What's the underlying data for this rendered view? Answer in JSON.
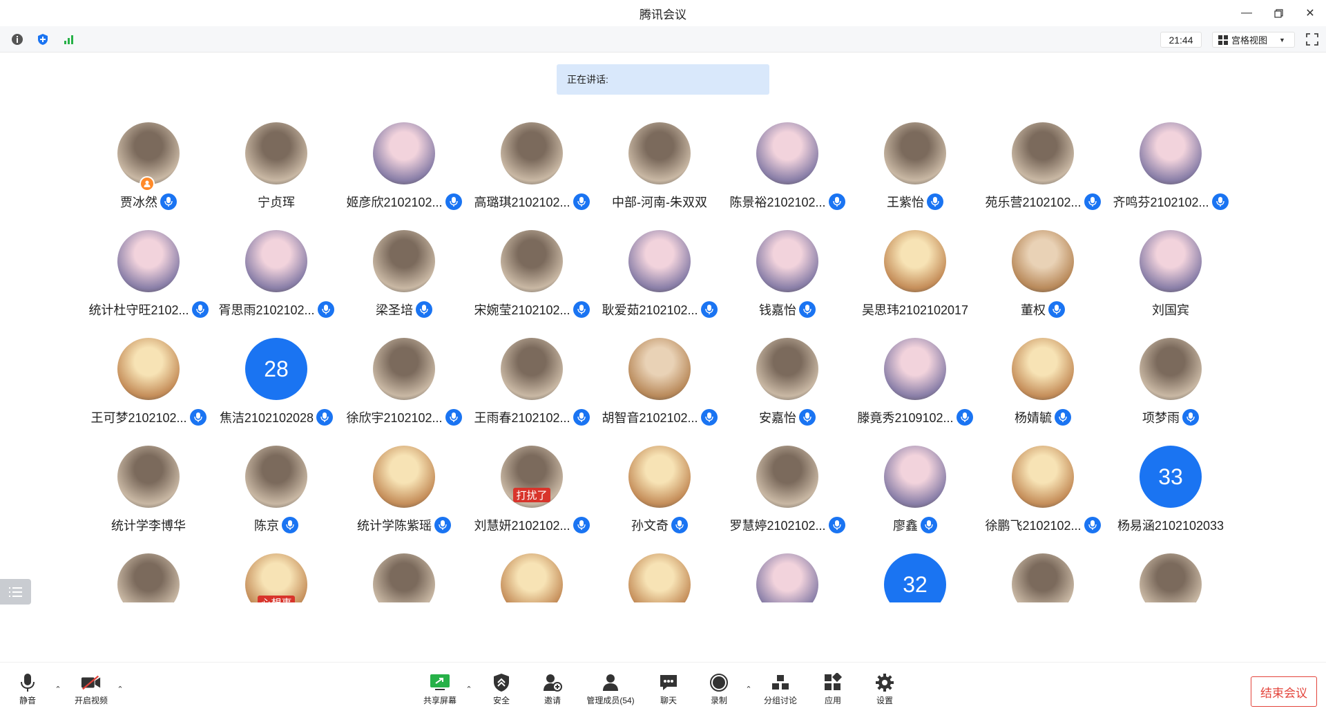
{
  "window": {
    "title": "腾讯会议"
  },
  "topbar": {
    "time": "21:44",
    "view_label": "宫格视图"
  },
  "speaker": {
    "label": "正在讲话:"
  },
  "participants": [
    {
      "name": "贾冰然",
      "avatar": "photo",
      "mic": true,
      "host": true
    },
    {
      "name": "宁贞珲",
      "avatar": "photo",
      "mic": false
    },
    {
      "name": "姬彦欣2102102...",
      "avatar": "anime",
      "mic": true
    },
    {
      "name": "高璐琪2102102...",
      "avatar": "photo",
      "mic": true
    },
    {
      "name": "中部-河南-朱双双",
      "avatar": "photo",
      "mic": false
    },
    {
      "name": "陈景裕2102102...",
      "avatar": "anime",
      "mic": true
    },
    {
      "name": "王紫怡",
      "avatar": "photo",
      "mic": true
    },
    {
      "name": "苑乐营2102102...",
      "avatar": "photo",
      "mic": true
    },
    {
      "name": "齐鸣芬2102102...",
      "avatar": "anime",
      "mic": true
    },
    {
      "name": "统计杜守旺2102...",
      "avatar": "anime",
      "mic": true
    },
    {
      "name": "胥思雨2102102...",
      "avatar": "anime",
      "mic": true
    },
    {
      "name": "梁圣培",
      "avatar": "photo",
      "mic": true
    },
    {
      "name": "宋婉莹2102102...",
      "avatar": "photo",
      "mic": true
    },
    {
      "name": "耿爱茹2102102...",
      "avatar": "anime",
      "mic": true
    },
    {
      "name": "钱嘉怡",
      "avatar": "anime",
      "mic": true
    },
    {
      "name": "吴思玮2102102017",
      "avatar": "cartoon",
      "mic": false
    },
    {
      "name": "董权",
      "avatar": "cat",
      "mic": true
    },
    {
      "name": "刘国宾",
      "avatar": "anime",
      "mic": false
    },
    {
      "name": "王可梦2102102...",
      "avatar": "cartoon",
      "mic": true
    },
    {
      "name": "焦洁2102102028",
      "avatar": "number",
      "number": "28",
      "mic": true
    },
    {
      "name": "徐欣宇2102102...",
      "avatar": "photo",
      "mic": true
    },
    {
      "name": "王雨春2102102...",
      "avatar": "photo",
      "mic": true
    },
    {
      "name": "胡智音2102102...",
      "avatar": "cat",
      "mic": true
    },
    {
      "name": "安嘉怡",
      "avatar": "photo",
      "mic": true
    },
    {
      "name": "滕竟秀2109102...",
      "avatar": "anime",
      "mic": true
    },
    {
      "name": "杨婧毓",
      "avatar": "cartoon",
      "mic": true
    },
    {
      "name": "项梦雨",
      "avatar": "photo",
      "mic": true
    },
    {
      "name": "统计学李博华",
      "avatar": "photo",
      "mic": false
    },
    {
      "name": "陈京",
      "avatar": "photo",
      "mic": true
    },
    {
      "name": "统计学陈紫瑶",
      "avatar": "cartoon",
      "mic": true
    },
    {
      "name": "刘慧妍2102102...",
      "avatar": "photo",
      "mic": true,
      "overlay": "打扰了"
    },
    {
      "name": "孙文奇",
      "avatar": "cartoon",
      "mic": true
    },
    {
      "name": "罗慧婷2102102...",
      "avatar": "photo",
      "mic": true
    },
    {
      "name": "廖鑫",
      "avatar": "anime",
      "mic": true
    },
    {
      "name": "徐鹏飞2102102...",
      "avatar": "cartoon",
      "mic": true
    },
    {
      "name": "杨易涵2102102033",
      "avatar": "number",
      "number": "33",
      "mic": false
    },
    {
      "name": "",
      "avatar": "photo",
      "mic": false
    },
    {
      "name": "",
      "avatar": "cartoon",
      "mic": false,
      "overlay": "心想事"
    },
    {
      "name": "",
      "avatar": "photo",
      "mic": false
    },
    {
      "name": "",
      "avatar": "cartoon",
      "mic": false
    },
    {
      "name": "",
      "avatar": "cartoon",
      "mic": false
    },
    {
      "name": "",
      "avatar": "anime",
      "mic": false
    },
    {
      "name": "",
      "avatar": "number",
      "number": "32",
      "mic": false
    },
    {
      "name": "",
      "avatar": "photo",
      "mic": false
    },
    {
      "name": "",
      "avatar": "photo",
      "mic": false
    }
  ],
  "toolbar": {
    "mute": "静音",
    "video": "开启视频",
    "share": "共享屏幕",
    "security": "安全",
    "invite": "邀请",
    "members": "管理成员(54)",
    "chat": "聊天",
    "record": "录制",
    "breakout": "分组讨论",
    "apps": "应用",
    "settings": "设置",
    "end": "结束会议"
  },
  "colors": {
    "accent": "#1a74f2",
    "end": "#e3433a",
    "speaker_bg": "#d9e8fb"
  }
}
